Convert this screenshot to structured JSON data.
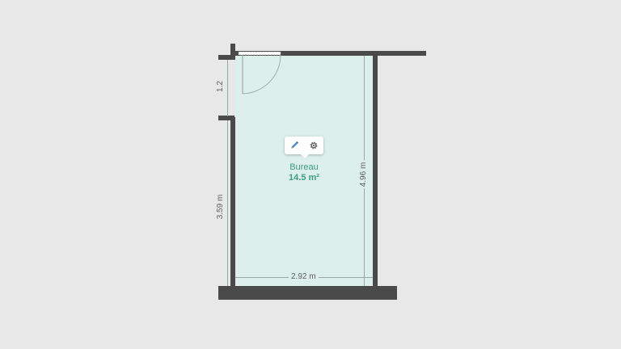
{
  "room": {
    "name": "Bureau",
    "area": "14.5 m²"
  },
  "toolbar": {
    "edit_icon": "pencil-icon",
    "settings_icon": "gear-icon"
  },
  "dimensions": {
    "door_width": "1.2",
    "left_wall": "3.59 m",
    "right_wall": "4.96 m",
    "bottom_wall": "2.92 m"
  },
  "colors": {
    "floor": "#dcefeb",
    "wall": "#4a4a4a",
    "label": "#3e9e7e",
    "background": "#e8e8e8"
  }
}
